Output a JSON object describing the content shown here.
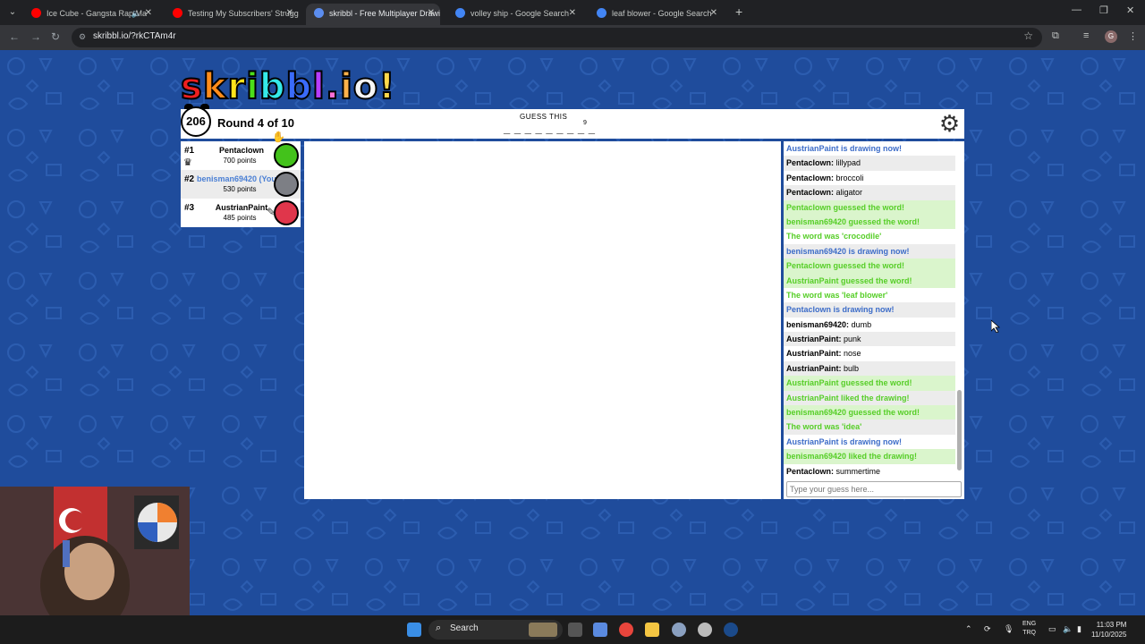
{
  "browser": {
    "tabs": [
      {
        "label": "Ice Cube - Gangsta Rap Ma",
        "favicon_color": "#ff0000",
        "active": false
      },
      {
        "label": "Testing My Subscribers' Strugg",
        "favicon_color": "#ff0000",
        "active": false
      },
      {
        "label": "skribbl - Free Multiplayer Drawi",
        "favicon_color": "#5b8def",
        "active": true
      },
      {
        "label": "volley ship - Google Search",
        "favicon_color": "#4285f4",
        "active": false
      },
      {
        "label": "leaf blower - Google Search",
        "favicon_color": "#4285f4",
        "active": false
      }
    ],
    "url": "skribbl.io/?rkCTAm4r"
  },
  "game": {
    "logo": [
      "s",
      "k",
      "r",
      "i",
      "b",
      "b",
      "l",
      ".",
      "i",
      "o",
      "!"
    ],
    "logo_colors": [
      "#ef1f1f",
      "#ff8c1a",
      "#ffe21a",
      "#4cde1a",
      "#35e9e9",
      "#3a6bfa",
      "#b63cff",
      "#ff6fd6",
      "#ffb24b",
      "#f6f6f6",
      "#ffd84b"
    ],
    "timer": "206",
    "round_text": "Round 4 of 10",
    "guess_label": "GUESS THIS",
    "word_blanks": "_ _ _ _ _ _ _ _ _",
    "word_length": "9",
    "players": [
      {
        "rank": "#1",
        "name": "Pentaclown",
        "points": "700 points",
        "avatar_color": "#43c21b",
        "me": false
      },
      {
        "rank": "#2",
        "name": "benisman69420 (You)",
        "points": "530 points",
        "avatar_color": "#7d7f85",
        "me": true
      },
      {
        "rank": "#3",
        "name": "AustrianPaint",
        "points": "485 points",
        "avatar_color": "#e0364b",
        "me": false
      }
    ]
  },
  "chat": {
    "messages": [
      {
        "type": "draw",
        "text": "AustrianPaint is drawing now!"
      },
      {
        "type": "user",
        "who": "Pentaclown:",
        "text": "lillypad"
      },
      {
        "type": "user",
        "who": "Pentaclown:",
        "text": "broccoli"
      },
      {
        "type": "user",
        "who": "Pentaclown:",
        "text": "aligator"
      },
      {
        "type": "sysbg",
        "text": "Pentaclown guessed the word!"
      },
      {
        "type": "sysbg",
        "text": "benisman69420 guessed the word!"
      },
      {
        "type": "sys",
        "text": "The word was 'crocodile'"
      },
      {
        "type": "draw",
        "text": "benisman69420 is drawing now!"
      },
      {
        "type": "sysbg",
        "text": "Pentaclown guessed the word!"
      },
      {
        "type": "sysbg",
        "text": "AustrianPaint guessed the word!"
      },
      {
        "type": "sys",
        "text": "The word was 'leaf blower'"
      },
      {
        "type": "draw",
        "text": "Pentaclown is drawing now!"
      },
      {
        "type": "user",
        "who": "benisman69420:",
        "text": "dumb"
      },
      {
        "type": "user",
        "who": "AustrianPaint:",
        "text": "punk"
      },
      {
        "type": "user",
        "who": "AustrianPaint:",
        "text": "nose"
      },
      {
        "type": "user",
        "who": "AustrianPaint:",
        "text": "bulb"
      },
      {
        "type": "sysbg",
        "text": "AustrianPaint guessed the word!"
      },
      {
        "type": "sys",
        "text": "AustrianPaint liked the drawing!"
      },
      {
        "type": "sysbg",
        "text": "benisman69420 guessed the word!"
      },
      {
        "type": "sys",
        "text": "The word was 'idea'"
      },
      {
        "type": "draw",
        "text": "AustrianPaint is drawing now!"
      },
      {
        "type": "sysbg",
        "text": "benisman69420 liked the drawing!"
      },
      {
        "type": "user",
        "who": "Pentaclown:",
        "text": "summertime"
      }
    ],
    "input_placeholder": "Type your guess here..."
  },
  "taskbar": {
    "search_label": "Search",
    "lang_top": "ENG",
    "lang_bottom": "TRQ",
    "time": "11:03 PM",
    "date": "11/10/2025"
  }
}
